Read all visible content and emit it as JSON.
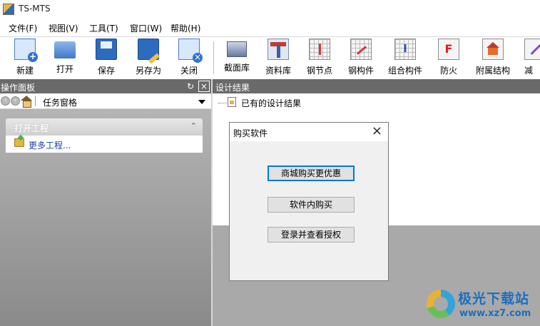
{
  "window": {
    "title": "TS-MTS"
  },
  "menu": [
    "文件(F)",
    "视图(V)",
    "工具(T)",
    "窗口(W)",
    "帮助(H)"
  ],
  "toolbar": [
    {
      "label": "新建",
      "icon": "new-file-icon"
    },
    {
      "label": "打开",
      "icon": "open-folder-icon"
    },
    {
      "label": "保存",
      "icon": "save-icon"
    },
    {
      "label": "另存为",
      "icon": "save-as-icon"
    },
    {
      "label": "关闭",
      "icon": "close-file-icon"
    },
    {
      "label": "截面库",
      "icon": "section-library-icon"
    },
    {
      "label": "资料库",
      "icon": "material-library-icon"
    },
    {
      "label": "钢节点",
      "icon": "steel-joint-icon"
    },
    {
      "label": "钢构件",
      "icon": "steel-member-icon"
    },
    {
      "label": "组合构件",
      "icon": "composite-member-icon"
    },
    {
      "label": "防火",
      "icon": "fireproof-icon"
    },
    {
      "label": "附属结构",
      "icon": "auxiliary-structure-icon"
    },
    {
      "label": "减",
      "icon": "reduce-icon"
    }
  ],
  "left_panel": {
    "title": "操作面板",
    "task_pane_label": "任务窗格",
    "group": {
      "title": "打开工程",
      "link": "更多工程..."
    }
  },
  "right_panel": {
    "title": "设计结果",
    "tree_item": "已有的设计结果"
  },
  "dialog": {
    "title": "购买软件",
    "buttons": [
      "商城购买更优惠",
      "软件内购买",
      "登录并查看授权"
    ]
  },
  "watermark": {
    "title": "极光下载站",
    "url": "www.xz7.com"
  }
}
